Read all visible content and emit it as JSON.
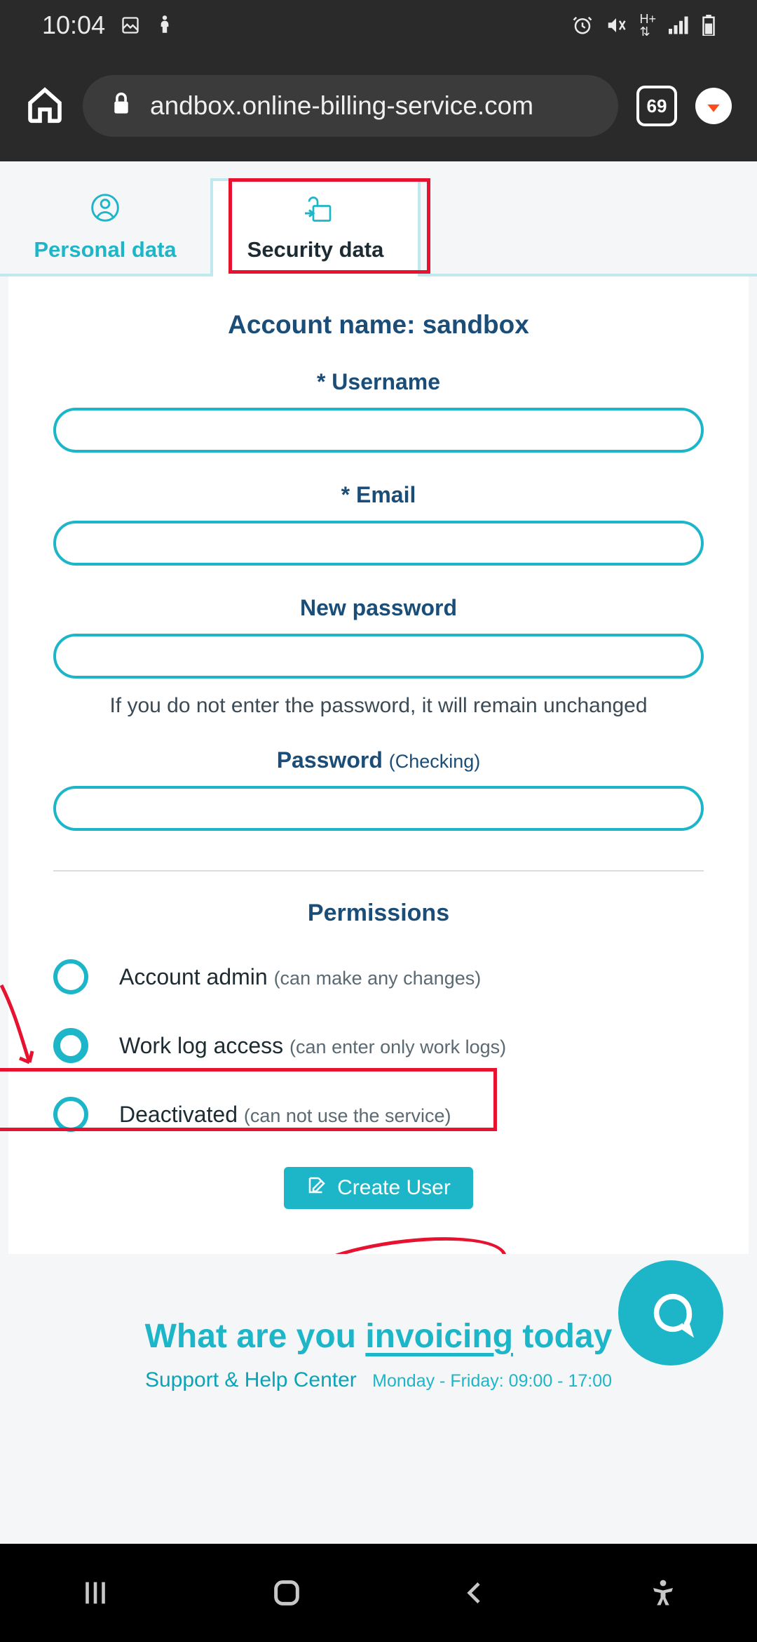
{
  "statusbar": {
    "time": "10:04"
  },
  "browser": {
    "url": "andbox.online-billing-service.com",
    "tab_count": "69"
  },
  "tabs": {
    "personal": "Personal data",
    "security": "Security data"
  },
  "form": {
    "account_name_label": "Account name: sandbox",
    "username_label": "* Username",
    "email_label": "* Email",
    "newpass_label": "New password",
    "newpass_hint": "If you do not enter the password, it will remain unchanged",
    "passcheck_label": "Password ",
    "passcheck_suffix": "(Checking)"
  },
  "permissions": {
    "title": "Permissions",
    "admin_label": "Account admin ",
    "admin_sub": "(can make any changes)",
    "worklog_label": "Work log access ",
    "worklog_sub": "(can enter only work logs)",
    "deact_label": "Deactivated ",
    "deact_sub": "(can not use the service)"
  },
  "button": {
    "create": "Create User"
  },
  "footer": {
    "promo_prefix": "What are you ",
    "promo_uline": "invoicing",
    "promo_suffix": " today",
    "support_label": "Support & Help Center",
    "support_hours": "Monday - Friday: 09:00 - 17:00"
  }
}
